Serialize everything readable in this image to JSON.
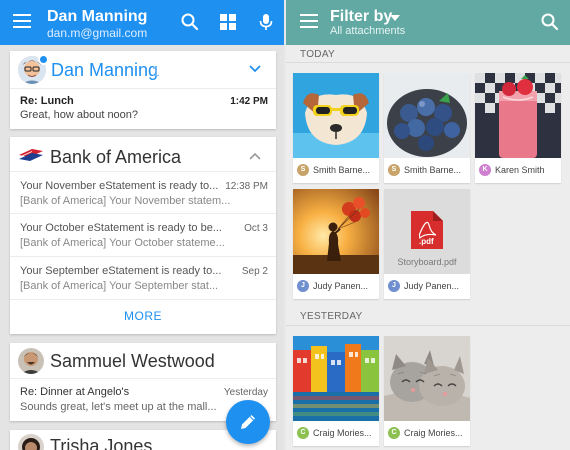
{
  "left": {
    "account_name": "Dan Manning",
    "account_email": "dan.m@gmail.com",
    "colors": {
      "bar": "#1e90f0",
      "accent": "#1e90f0"
    },
    "card1": {
      "sender": "Dan Manning",
      "count": "1",
      "subject": "Re: Lunch",
      "preview": "Great, how about noon?",
      "time": "1:42 PM"
    },
    "card2": {
      "sender": "Bank of America",
      "rows": [
        {
          "subject": "Your November eStatement is ready to...",
          "preview": "[Bank of America] Your November statem...",
          "time": "12:38 PM"
        },
        {
          "subject": "Your October eStatement is ready to be...",
          "preview": "[Bank of America] Your October stateme...",
          "time": "Oct 3"
        },
        {
          "subject": "Your September eStatement is ready to...",
          "preview": "[Bank of America] Your September stat...",
          "time": "Sep 2"
        }
      ],
      "more_label": "MORE"
    },
    "card3": {
      "sender": "Sammuel Westwood",
      "subject": "Re: Dinner at Angelo's",
      "preview": "Sounds great, let's meet up at the mall...",
      "time": "Yesterday"
    },
    "card4": {
      "sender": "Trisha Jones"
    }
  },
  "right": {
    "filter_title": "Filter by",
    "filter_subtitle": "All attachments",
    "colors": {
      "bar": "#62a9a3"
    },
    "today_label": "TODAY",
    "yesterday_label": "YESTERDAY",
    "today_tiles": [
      {
        "initial": "S",
        "chip_color": "#c9a46a",
        "name": "Smith Barne..."
      },
      {
        "initial": "S",
        "chip_color": "#c9a46a",
        "name": "Smith Barne..."
      },
      {
        "initial": "K",
        "chip_color": "#cf7fd0",
        "name": "Karen Smith"
      },
      {
        "initial": "J",
        "chip_color": "#6f8fcf",
        "name": "Judy Panen..."
      },
      {
        "initial": "J",
        "chip_color": "#6f8fcf",
        "name": "Judy Panen...",
        "file_label": "Storyboard.pdf",
        "file_type": ".pdf"
      }
    ],
    "yesterday_tiles": [
      {
        "initial": "C",
        "chip_color": "#8cc152",
        "name": "Craig Mories..."
      },
      {
        "initial": "C",
        "chip_color": "#8cc152",
        "name": "Craig Mories..."
      }
    ]
  }
}
